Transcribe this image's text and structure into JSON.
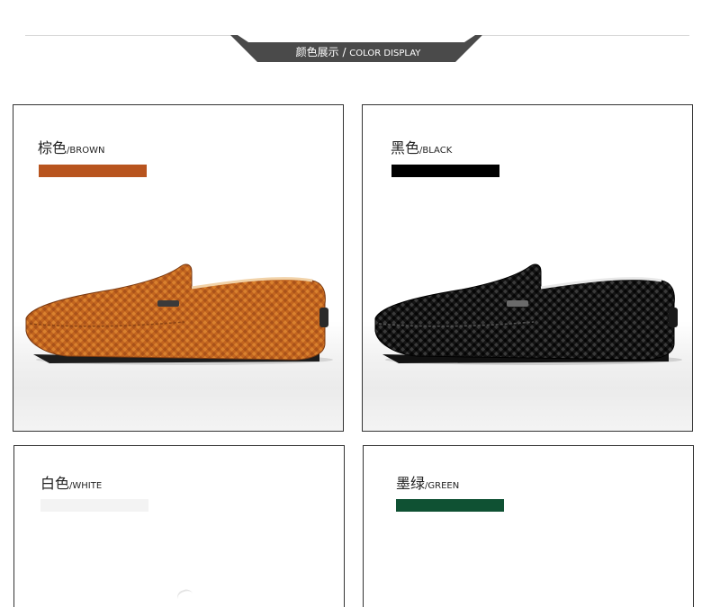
{
  "header": {
    "title_zh": "颜色展示",
    "separator": " / ",
    "title_en": "COLOR DISPLAY",
    "banner_color": "#4a4a4a"
  },
  "colors": [
    {
      "name_zh": "棕色",
      "name_en": "/BROWN",
      "swatch": "#b8541e",
      "shoe": "brown-loafer-image"
    },
    {
      "name_zh": "黑色",
      "name_en": "/BLACK",
      "swatch": "#000000",
      "shoe": "black-loafer-image"
    },
    {
      "name_zh": "白色",
      "name_en": "/WHITE",
      "swatch": "#f3f3f3",
      "shoe": "white-loafer-image"
    },
    {
      "name_zh": "墨绿",
      "name_en": "/GREEN",
      "swatch": "#0f5133",
      "shoe": "green-loafer-image"
    }
  ]
}
